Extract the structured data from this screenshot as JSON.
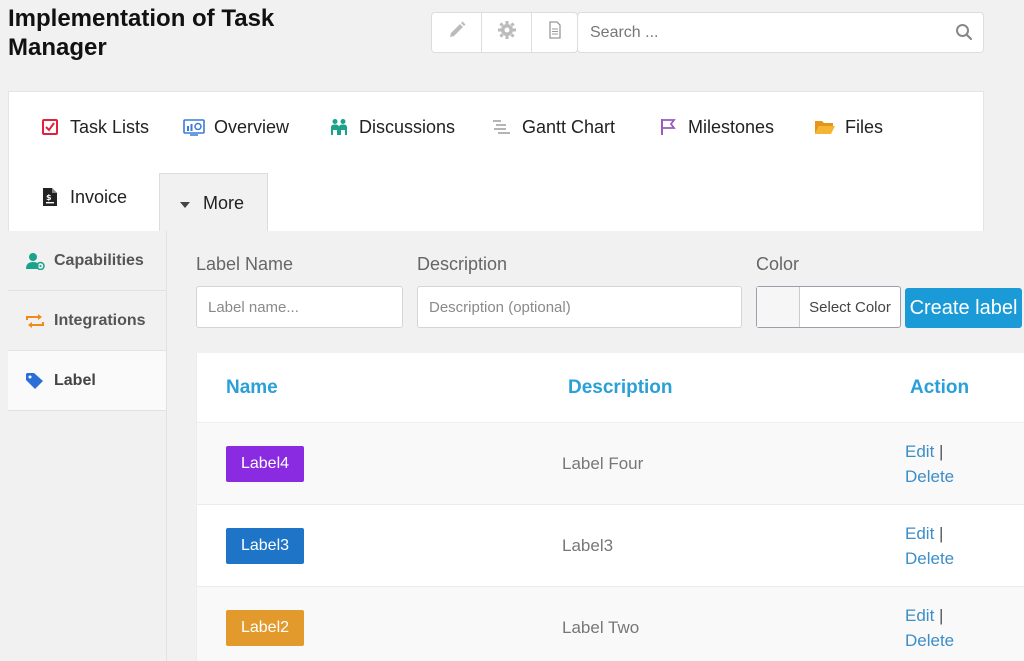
{
  "page": {
    "title": "Implementation of Task Manager"
  },
  "toolbar": {
    "buttons": [
      {
        "icon": "pencil-icon"
      },
      {
        "icon": "gear-icon"
      },
      {
        "icon": "document-icon"
      }
    ]
  },
  "search": {
    "placeholder": "Search ...",
    "value": ""
  },
  "nav": {
    "tabs": [
      {
        "label": "Task Lists",
        "icon": "task-list-icon",
        "color": "#e2223c"
      },
      {
        "label": "Overview",
        "icon": "overview-icon",
        "color": "#3a7bd5"
      },
      {
        "label": "Discussions",
        "icon": "discussions-icon",
        "color": "#1aa38a"
      },
      {
        "label": "Gantt Chart",
        "icon": "gantt-icon",
        "color": "#aaaaaa"
      },
      {
        "label": "Milestones",
        "icon": "milestone-flag-icon",
        "color": "#9a5bbf"
      },
      {
        "label": "Files",
        "icon": "folder-icon",
        "color": "#f0a020"
      },
      {
        "label": "Invoice",
        "icon": "invoice-icon",
        "color": "#222222"
      }
    ],
    "more_label": "More"
  },
  "sidebar": {
    "items": [
      {
        "label": "Capabilities",
        "icon": "capabilities-icon",
        "color": "#1aa38a"
      },
      {
        "label": "Integrations",
        "icon": "integrations-icon",
        "color": "#f08a1a"
      },
      {
        "label": "Label",
        "icon": "tag-icon",
        "color": "#2b6fd6",
        "active": true
      }
    ]
  },
  "form": {
    "label_name": {
      "label": "Label Name",
      "placeholder": "Label name...",
      "value": ""
    },
    "description": {
      "label": "Description",
      "placeholder": "Description (optional)",
      "value": ""
    },
    "color": {
      "label": "Color",
      "button": "Select Color"
    },
    "create_button": "Create label"
  },
  "table": {
    "headers": {
      "name": "Name",
      "description": "Description",
      "action": "Action"
    },
    "rows": [
      {
        "name": "Label4",
        "color": "#8a2be2",
        "description": "Label Four",
        "edit": "Edit",
        "sep": "|",
        "delete": "Delete"
      },
      {
        "name": "Label3",
        "color": "#1e74c6",
        "description": "Label3",
        "edit": "Edit",
        "sep": "|",
        "delete": "Delete"
      },
      {
        "name": "Label2",
        "color": "#e39a2c",
        "description": "Label Two",
        "edit": "Edit",
        "sep": "|",
        "delete": "Delete"
      }
    ]
  }
}
